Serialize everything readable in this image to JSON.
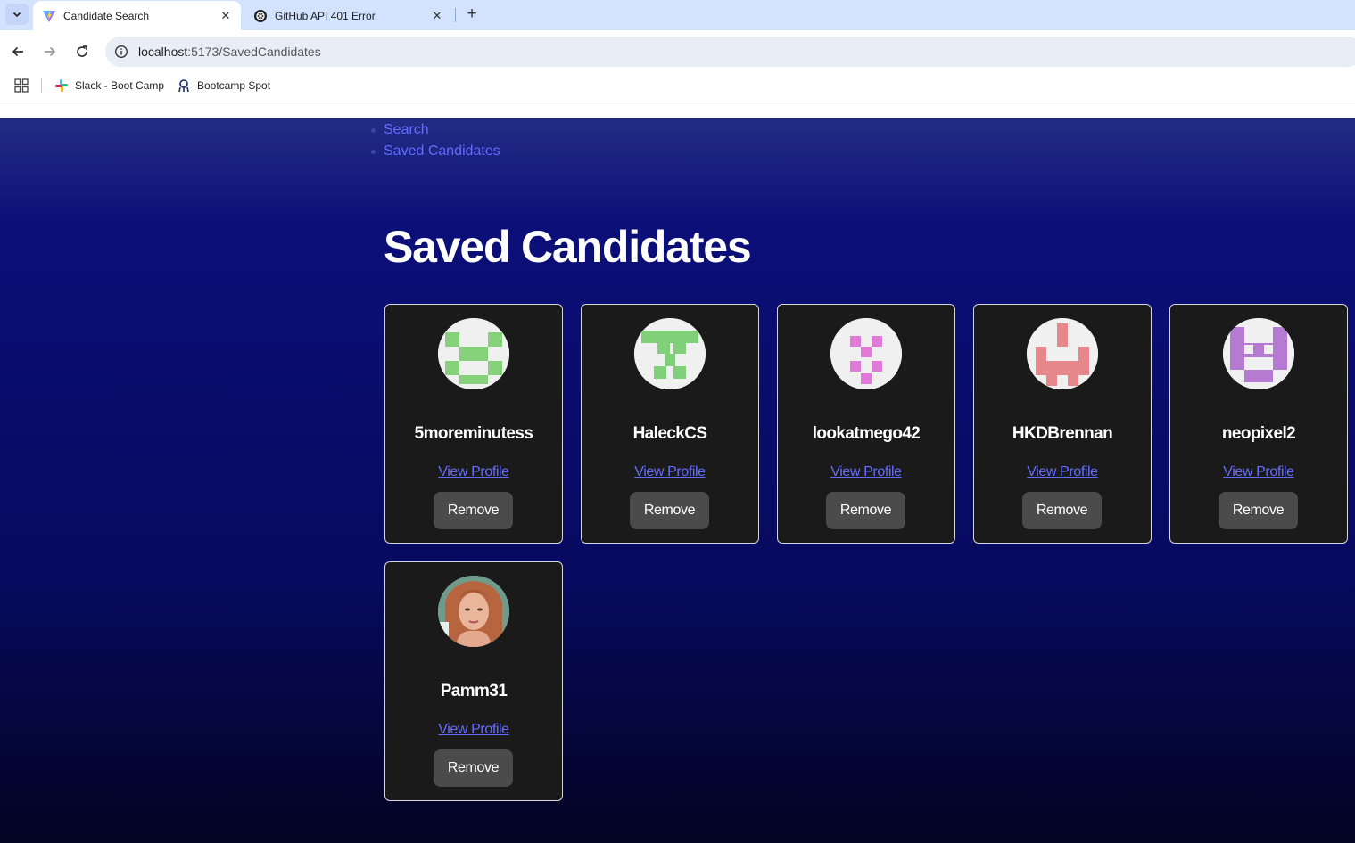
{
  "browser": {
    "tabs": [
      {
        "title": "Candidate Search",
        "active": true,
        "favicon": "vite-logo-icon"
      },
      {
        "title": "GitHub API 401 Error",
        "active": false,
        "favicon": "openai-logo-icon"
      }
    ],
    "url_host": "localhost",
    "url_path": ":5173/SavedCandidates",
    "bookmarks": [
      {
        "label": "Slack - Boot Camp",
        "icon": "slack-icon"
      },
      {
        "label": "Bootcamp Spot",
        "icon": "bootcamp-spot-icon"
      }
    ]
  },
  "nav": {
    "items": [
      {
        "label": "Search"
      },
      {
        "label": "Saved Candidates"
      }
    ]
  },
  "page": {
    "heading": "Saved Candidates"
  },
  "candidates": [
    {
      "username": "5moreminutess",
      "link_label": "View Profile",
      "button_label": "Remove",
      "avatar": "identicon",
      "avatar_color": "#86d27a"
    },
    {
      "username": "HaleckCS",
      "link_label": "View Profile",
      "button_label": "Remove",
      "avatar": "identicon",
      "avatar_color": "#7fd078"
    },
    {
      "username": "lookatmego42",
      "link_label": "View Profile",
      "button_label": "Remove",
      "avatar": "identicon",
      "avatar_color": "#e07ad6"
    },
    {
      "username": "HKDBrennan",
      "link_label": "View Profile",
      "button_label": "Remove",
      "avatar": "identicon",
      "avatar_color": "#e6878b"
    },
    {
      "username": "neopixel2",
      "link_label": "View Profile",
      "button_label": "Remove",
      "avatar": "identicon",
      "avatar_color": "#b57ad2"
    },
    {
      "username": "Pamm31",
      "link_label": "View Profile",
      "button_label": "Remove",
      "avatar": "photo",
      "avatar_color": "#c58a6a"
    }
  ],
  "colors": {
    "link": "#646cff",
    "card_bg": "#1a1a1a",
    "button_bg": "#4b4b4b",
    "page_top": "#232d84",
    "page_bottom": "#030322"
  }
}
